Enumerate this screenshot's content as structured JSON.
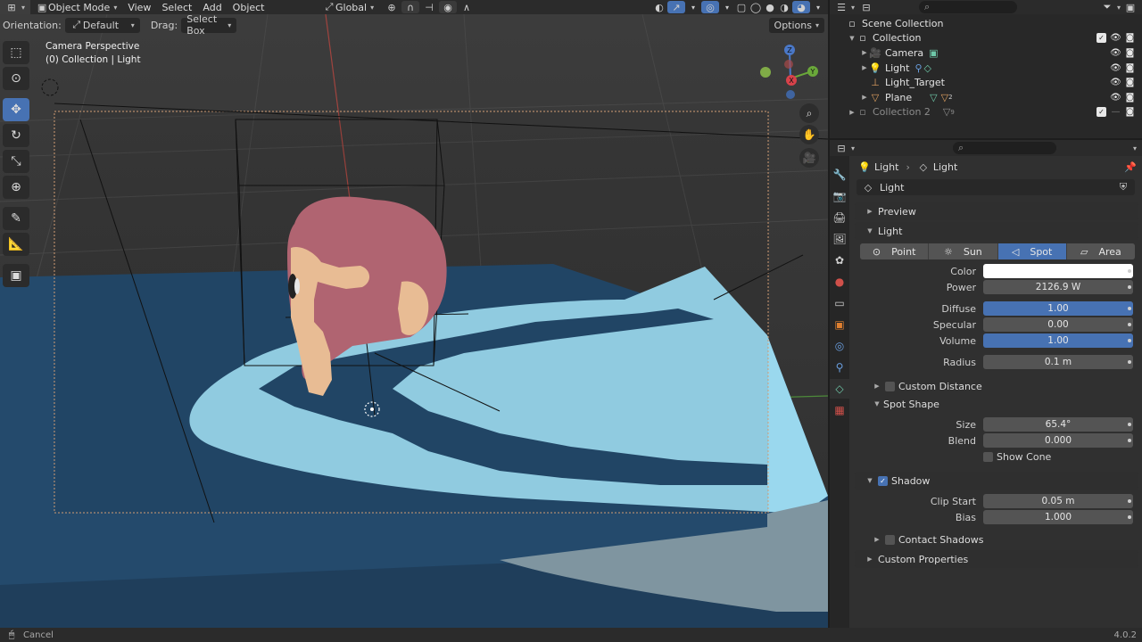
{
  "header": {
    "mode_label": "Object Mode",
    "menus": [
      "View",
      "Select",
      "Add",
      "Object"
    ],
    "transform_label": "Global"
  },
  "tool_settings": {
    "orientation_label": "Orientation:",
    "orientation_value": "Default",
    "drag_label": "Drag:",
    "drag_value": "Select Box",
    "options_label": "Options"
  },
  "viewport": {
    "camera_label": "Camera Perspective",
    "collection_label": "(0) Collection | Light",
    "axis_x": "X",
    "axis_y": "Y",
    "axis_z": "Z"
  },
  "outliner": {
    "rows": [
      {
        "label": "Scene Collection"
      },
      {
        "label": "Collection"
      },
      {
        "label": "Camera"
      },
      {
        "label": "Light"
      },
      {
        "label": "Light_Target"
      },
      {
        "label": "Plane",
        "count": "2"
      },
      {
        "label": "Collection 2",
        "count": "9"
      }
    ]
  },
  "properties": {
    "breadcrumb_object": "Light",
    "breadcrumb_data": "Light",
    "data_name": "Light",
    "preview_label": "Preview",
    "light_label": "Light",
    "types": [
      "Point",
      "Sun",
      "Spot",
      "Area"
    ],
    "active_type": "Spot",
    "color_label": "Color",
    "color_value": "#ffffff",
    "power_label": "Power",
    "power_value": "2126.9 W",
    "diffuse_label": "Diffuse",
    "diffuse_value": "1.00",
    "specular_label": "Specular",
    "specular_value": "0.00",
    "volume_label": "Volume",
    "volume_value": "1.00",
    "radius_label": "Radius",
    "radius_value": "0.1 m",
    "custom_distance_label": "Custom Distance",
    "spot_shape_label": "Spot Shape",
    "size_label": "Size",
    "size_value": "65.4°",
    "blend_label": "Blend",
    "blend_value": "0.000",
    "show_cone_label": "Show Cone",
    "shadow_label": "Shadow",
    "clip_start_label": "Clip Start",
    "clip_start_value": "0.05 m",
    "bias_label": "Bias",
    "bias_value": "1.000",
    "contact_shadows_label": "Contact Shadows",
    "custom_properties_label": "Custom Properties"
  },
  "statusbar": {
    "left": "Cancel",
    "version": "4.0.2"
  },
  "colors": {
    "accent": "#4772b3",
    "floor_dark": "#244a6c",
    "floor_lit": "#9ad8ee",
    "head": "#b06471",
    "face": "#e8bc94"
  }
}
